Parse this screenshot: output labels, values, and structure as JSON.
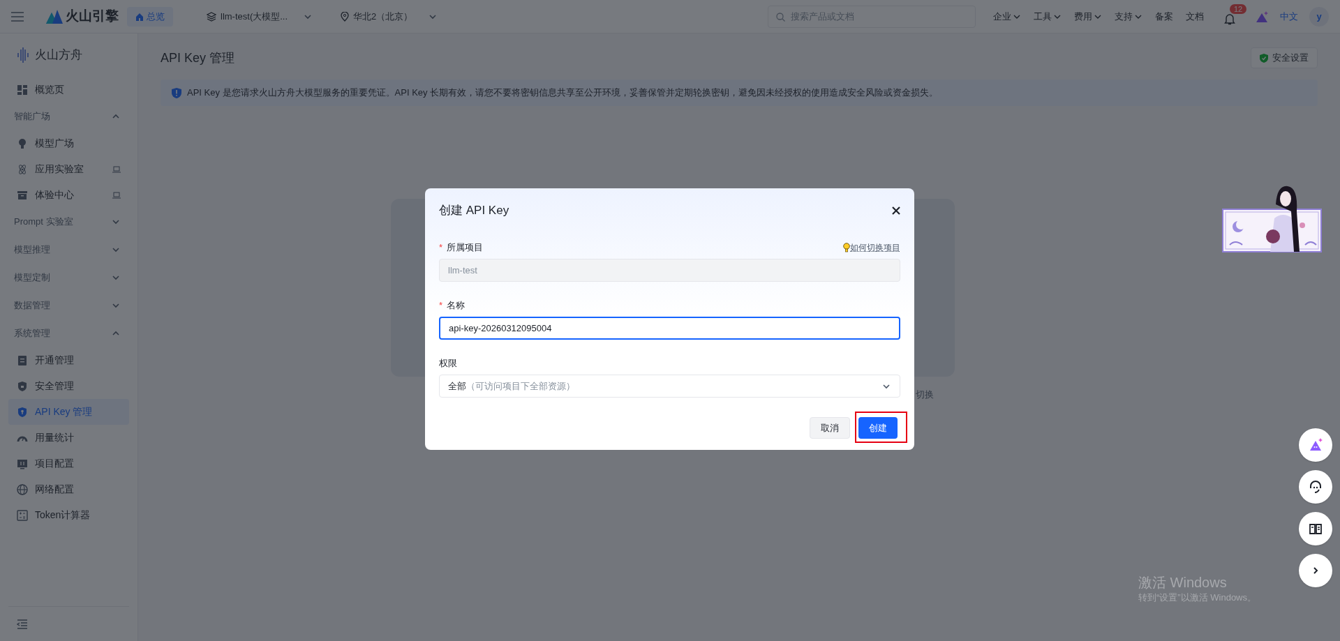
{
  "top_bar": {
    "home_label": "总览",
    "project": "llm-test(大模型...",
    "region": "华北2（北京）",
    "search": {
      "placeholder": "搜索产品或文档"
    },
    "menus": [
      {
        "label": "企业",
        "dropdown": true
      },
      {
        "label": "工具",
        "dropdown": true
      },
      {
        "label": "费用",
        "dropdown": true
      },
      {
        "label": "支持",
        "dropdown": true
      },
      {
        "label": "备案",
        "dropdown": false
      },
      {
        "label": "文档",
        "dropdown": false
      }
    ],
    "notifications": "12",
    "language": "中文",
    "avatar": "y"
  },
  "brand": "火山引擎",
  "sidebar": {
    "title": "火山方舟",
    "items": [
      {
        "kind": "item",
        "label": "概览页",
        "selected": false,
        "trailing_icon": false
      },
      {
        "kind": "group",
        "label": "智能广场",
        "expanded": true,
        "children": [
          {
            "kind": "item",
            "label": "模型广场",
            "selected": false,
            "trailing_icon": false
          },
          {
            "kind": "item",
            "label": "应用实验室",
            "selected": false,
            "trailing_icon": true
          },
          {
            "kind": "item",
            "label": "体验中心",
            "selected": false,
            "trailing_icon": true
          }
        ]
      },
      {
        "kind": "group",
        "label": "Prompt 实验室",
        "expanded": false
      },
      {
        "kind": "group",
        "label": "模型推理",
        "expanded": false
      },
      {
        "kind": "group",
        "label": "模型定制",
        "expanded": false
      },
      {
        "kind": "group",
        "label": "数据管理",
        "expanded": false
      },
      {
        "kind": "group",
        "label": "系统管理",
        "expanded": true,
        "children": [
          {
            "kind": "item",
            "label": "开通管理",
            "selected": false,
            "trailing_icon": false
          },
          {
            "kind": "item",
            "label": "安全管理",
            "selected": false,
            "trailing_icon": false
          },
          {
            "kind": "item",
            "label": "API Key 管理",
            "selected": true,
            "trailing_icon": false
          },
          {
            "kind": "item",
            "label": "用量统计",
            "selected": false,
            "trailing_icon": false
          },
          {
            "kind": "item",
            "label": "项目配置",
            "selected": false,
            "trailing_icon": false
          },
          {
            "kind": "item",
            "label": "网络配置",
            "selected": false,
            "trailing_icon": false
          },
          {
            "kind": "item",
            "label": "Token计算器",
            "selected": false,
            "trailing_icon": false
          }
        ]
      }
    ]
  },
  "page": {
    "title": "API Key 管理",
    "settings_button": "安全设置",
    "notice": "API Key 是您请求火山方舟大模型服务的重要凭证。API Key 长期有效，请您不要将密钥信息共享至公开环境，妥善保管并定期轮换密钥，避免因未经授权的使用造成安全风险或资金损失。",
    "hidden_text": "切换"
  },
  "dialog": {
    "title": "创建 API Key",
    "fields": [
      {
        "kind": "readonly",
        "label": "所属项目",
        "required_mark": "*",
        "help": "如何切换项目",
        "value": "llm-test"
      },
      {
        "kind": "text",
        "label": "名称",
        "required_mark": "*",
        "focused": true,
        "value": "api-key-20260312095004"
      },
      {
        "kind": "select",
        "label": "权限",
        "value": "全部",
        "hint": "（可访问项目下全部资源）"
      }
    ],
    "buttons": [
      {
        "label": "取消",
        "primary": false,
        "highlighted": false
      },
      {
        "label": "创建",
        "primary": true,
        "highlighted": true
      }
    ]
  },
  "watermark": {
    "title": "激活 Windows",
    "subtitle": "转到“设置”以激活 Windows。"
  }
}
